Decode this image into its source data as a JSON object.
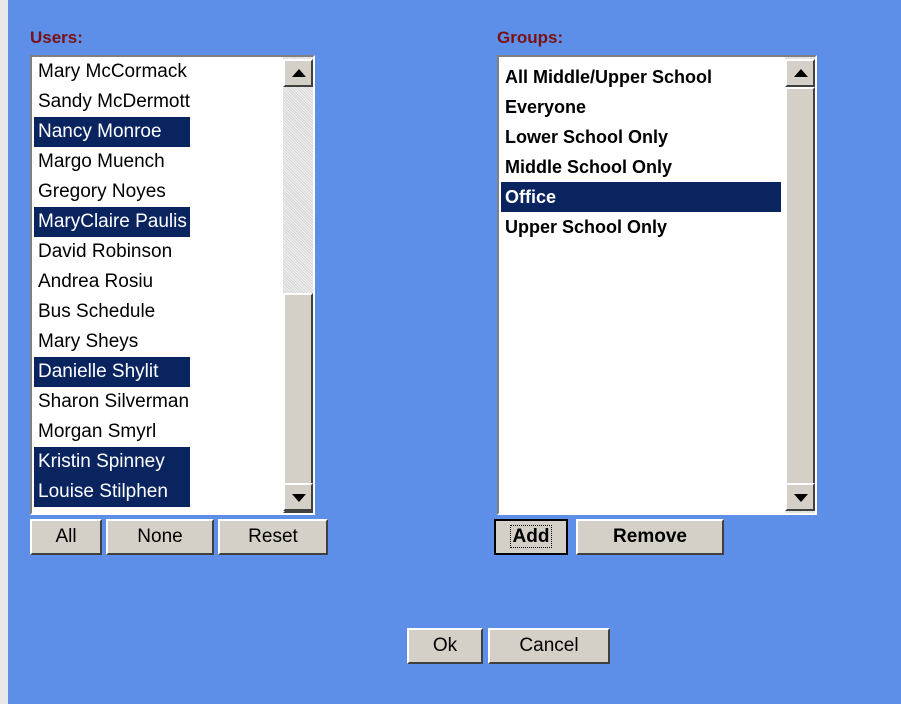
{
  "users": {
    "label": "Users:",
    "items": [
      {
        "name": "Mary McCormack",
        "selected": false
      },
      {
        "name": "Sandy McDermott",
        "selected": false
      },
      {
        "name": "Nancy Monroe",
        "selected": true
      },
      {
        "name": "Margo Muench",
        "selected": false
      },
      {
        "name": "Gregory Noyes",
        "selected": false
      },
      {
        "name": "MaryClaire Paulis",
        "selected": true
      },
      {
        "name": "David Robinson",
        "selected": false
      },
      {
        "name": "Andrea Rosiu",
        "selected": false
      },
      {
        "name": "Bus Schedule",
        "selected": false
      },
      {
        "name": "Mary Sheys",
        "selected": false
      },
      {
        "name": "Danielle Shylit",
        "selected": true
      },
      {
        "name": "Sharon Silverman",
        "selected": false
      },
      {
        "name": "Morgan Smyrl",
        "selected": false
      },
      {
        "name": "Kristin Spinney",
        "selected": true
      },
      {
        "name": "Louise Stilphen",
        "selected": true
      }
    ],
    "buttons": {
      "all": "All",
      "none": "None",
      "reset": "Reset"
    }
  },
  "groups": {
    "label": "Groups:",
    "items": [
      {
        "name": "All Middle/Upper School",
        "selected": false
      },
      {
        "name": "Everyone",
        "selected": false
      },
      {
        "name": "Lower School Only",
        "selected": false
      },
      {
        "name": "Middle School Only",
        "selected": false
      },
      {
        "name": "Office",
        "selected": true
      },
      {
        "name": "Upper School Only",
        "selected": false
      }
    ],
    "buttons": {
      "add": "Add",
      "remove": "Remove"
    }
  },
  "dialog": {
    "ok": "Ok",
    "cancel": "Cancel"
  },
  "colors": {
    "background": "#5e8fe8",
    "selection": "#0a2460",
    "label": "#7a1010"
  }
}
